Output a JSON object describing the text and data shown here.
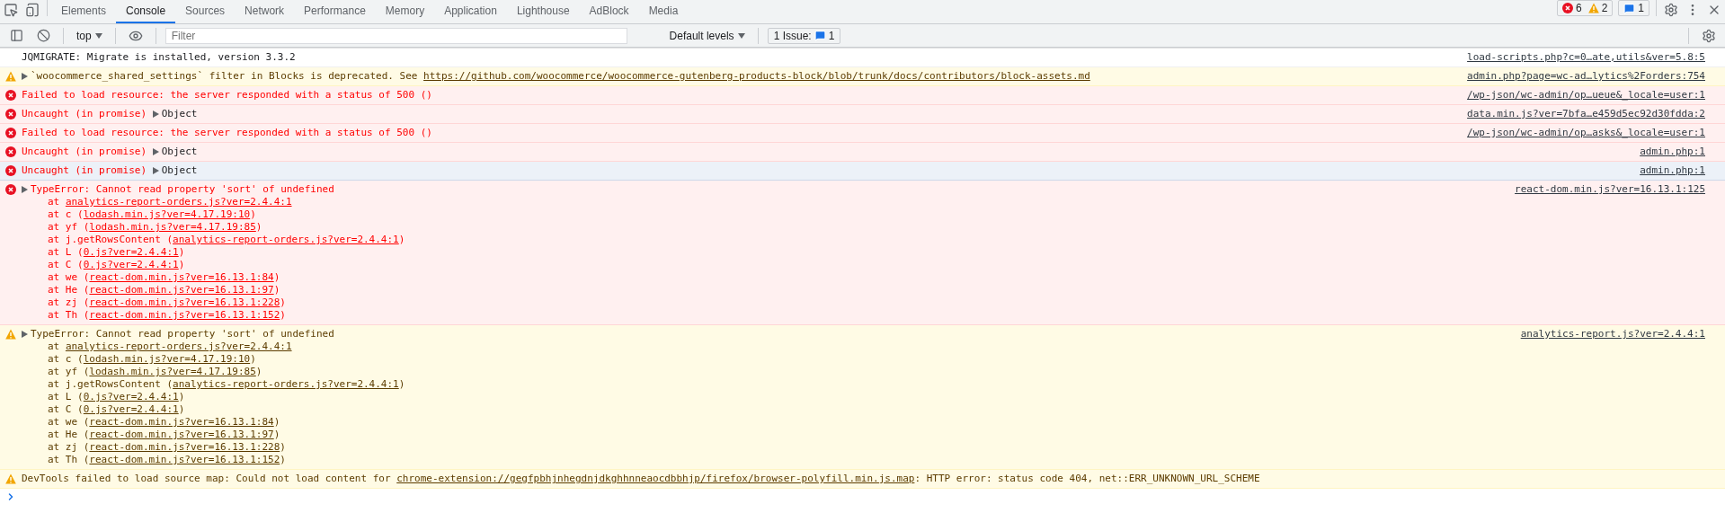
{
  "tabs": [
    {
      "label": "Elements",
      "selected": false
    },
    {
      "label": "Console",
      "selected": true
    },
    {
      "label": "Sources",
      "selected": false
    },
    {
      "label": "Network",
      "selected": false
    },
    {
      "label": "Performance",
      "selected": false
    },
    {
      "label": "Memory",
      "selected": false
    },
    {
      "label": "Application",
      "selected": false
    },
    {
      "label": "Lighthouse",
      "selected": false
    },
    {
      "label": "AdBlock",
      "selected": false
    },
    {
      "label": "Media",
      "selected": false
    }
  ],
  "counters": {
    "errors": "6",
    "warnings": "2",
    "messages": "1"
  },
  "toolbar": {
    "context": "top",
    "filter": {
      "placeholder": "Filter"
    },
    "levels": "Default levels",
    "issues_label": "1 Issue:",
    "issues_count": "1"
  },
  "messages": [
    {
      "kind": "info",
      "selected": false,
      "expandable": false,
      "text": "JQMIGRATE: Migrate is installed, version 3.3.2",
      "source": "load-scripts.php?c=0…ate,utils&ver=5.8:5"
    },
    {
      "kind": "warning",
      "selected": false,
      "expandable": true,
      "text": "`woocommerce_shared_settings` filter in Blocks is deprecated. See ",
      "link": "https://github.com/woocommerce/woocommerce-gutenberg-products-block/blob/trunk/docs/contributors/block-assets.md",
      "source": "admin.php?page=wc-ad…lytics%2Forders:754"
    },
    {
      "kind": "error",
      "selected": false,
      "expandable": false,
      "text": "Failed to load resource: the server responded with a status of 500 ()",
      "source": "/wp-json/wc-admin/op…ueue&_locale=user:1"
    },
    {
      "kind": "error",
      "selected": false,
      "expandable": false,
      "text": "Uncaught (in promise) ",
      "object": "Object",
      "source": "data.min.js?ver=7bfa…e459d5ec92d30fdda:2"
    },
    {
      "kind": "error",
      "selected": false,
      "expandable": false,
      "text": "Failed to load resource: the server responded with a status of 500 ()",
      "source": "/wp-json/wc-admin/op…asks&_locale=user:1"
    },
    {
      "kind": "error",
      "selected": false,
      "expandable": false,
      "text": "Uncaught (in promise) ",
      "object": "Object",
      "source": "admin.php:1"
    },
    {
      "kind": "error",
      "selected": true,
      "expandable": false,
      "text": "Uncaught (in promise) ",
      "object": "Object",
      "source": "admin.php:1"
    },
    {
      "kind": "error",
      "selected": false,
      "expandable": true,
      "text": "TypeError: Cannot read property 'sort' of undefined",
      "source": "react-dom.min.js?ver=16.13.1:125",
      "stack": [
        {
          "text": "at ",
          "link": "analytics-report-orders.js?ver=2.4.4:1"
        },
        {
          "text": "at c (",
          "link": "lodash.min.js?ver=4.17.19:10",
          "after": ")"
        },
        {
          "text": "at yf (",
          "link": "lodash.min.js?ver=4.17.19:85",
          "after": ")"
        },
        {
          "text": "at j.getRowsContent (",
          "link": "analytics-report-orders.js?ver=2.4.4:1",
          "after": ")"
        },
        {
          "text": "at L (",
          "link": "0.js?ver=2.4.4:1",
          "after": ")"
        },
        {
          "text": "at C (",
          "link": "0.js?ver=2.4.4:1",
          "after": ")"
        },
        {
          "text": "at we (",
          "link": "react-dom.min.js?ver=16.13.1:84",
          "after": ")"
        },
        {
          "text": "at He (",
          "link": "react-dom.min.js?ver=16.13.1:97",
          "after": ")"
        },
        {
          "text": "at zj (",
          "link": "react-dom.min.js?ver=16.13.1:228",
          "after": ")"
        },
        {
          "text": "at Th (",
          "link": "react-dom.min.js?ver=16.13.1:152",
          "after": ")"
        }
      ]
    },
    {
      "kind": "warning",
      "selected": false,
      "expandable": true,
      "text": "TypeError: Cannot read property 'sort' of undefined",
      "source": "analytics-report.js?ver=2.4.4:1",
      "stack": [
        {
          "text": "at ",
          "link": "analytics-report-orders.js?ver=2.4.4:1"
        },
        {
          "text": "at c (",
          "link": "lodash.min.js?ver=4.17.19:10",
          "after": ")"
        },
        {
          "text": "at yf (",
          "link": "lodash.min.js?ver=4.17.19:85",
          "after": ")"
        },
        {
          "text": "at j.getRowsContent (",
          "link": "analytics-report-orders.js?ver=2.4.4:1",
          "after": ")"
        },
        {
          "text": "at L (",
          "link": "0.js?ver=2.4.4:1",
          "after": ")"
        },
        {
          "text": "at C (",
          "link": "0.js?ver=2.4.4:1",
          "after": ")"
        },
        {
          "text": "at we (",
          "link": "react-dom.min.js?ver=16.13.1:84",
          "after": ")"
        },
        {
          "text": "at He (",
          "link": "react-dom.min.js?ver=16.13.1:97",
          "after": ")"
        },
        {
          "text": "at zj (",
          "link": "react-dom.min.js?ver=16.13.1:228",
          "after": ")"
        },
        {
          "text": "at Th (",
          "link": "react-dom.min.js?ver=16.13.1:152",
          "after": ")"
        }
      ]
    },
    {
      "kind": "warning",
      "selected": false,
      "expandable": false,
      "text": "DevTools failed to load source map: Could not load content for ",
      "link": "chrome-extension://gegfpbhjnhegdnjdkghhnneaocdbbhjp/firefox/browser-polyfill.min.js.map",
      "after": ": HTTP error: status code 404, net::ERR_UNKNOWN_URL_SCHEME"
    }
  ]
}
